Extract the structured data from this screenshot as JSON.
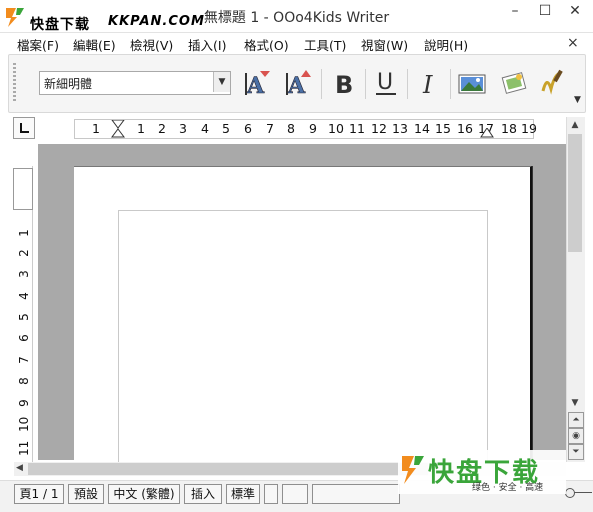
{
  "window": {
    "title": "無標題 1 - OOo4Kids Writer",
    "minimize": "–",
    "maximize": "☐",
    "close": "✕"
  },
  "watermark_top": {
    "cn": "快盘下载",
    "en": "KKPAN.COM"
  },
  "menubar": {
    "items": [
      "檔案(F)",
      "編輯(E)",
      "檢視(V)",
      "插入(I)",
      "格式(O)",
      "工具(T)",
      "視窗(W)",
      "說明(H)"
    ],
    "doc_close": "×"
  },
  "toolbar": {
    "font_name": "新細明體",
    "buttons": [
      {
        "name": "shrink-font-icon"
      },
      {
        "name": "grow-font-icon"
      },
      {
        "name": "bold-icon",
        "glyph": "B"
      },
      {
        "name": "underline-icon",
        "glyph": "U"
      },
      {
        "name": "italic-icon",
        "glyph": "I"
      },
      {
        "name": "insert-image-icon"
      },
      {
        "name": "gallery-icon"
      },
      {
        "name": "highlighter-icon"
      }
    ]
  },
  "ruler": {
    "horizontal": [
      "1",
      "1",
      "2",
      "3",
      "4",
      "5",
      "6",
      "7",
      "8",
      "9",
      "10",
      "11",
      "12",
      "13",
      "14",
      "15",
      "16",
      "17",
      "18",
      "19"
    ],
    "vertical": [
      "1",
      "1",
      "2",
      "3",
      "4",
      "5",
      "6",
      "7",
      "8",
      "9",
      "10",
      "11"
    ]
  },
  "statusbar": {
    "page": "頁1 / 1",
    "style": "預設",
    "language": "中文 (繁體)",
    "insert_mode": "插入",
    "selection_mode": "標準"
  },
  "watermark_bottom": {
    "big": "快盘下载",
    "small": "绿色 · 安全 · 高速"
  },
  "colors": {
    "accent_orange": "#f28c1e",
    "accent_green": "#3aa53a",
    "page_bg": "#a9a9a9"
  }
}
